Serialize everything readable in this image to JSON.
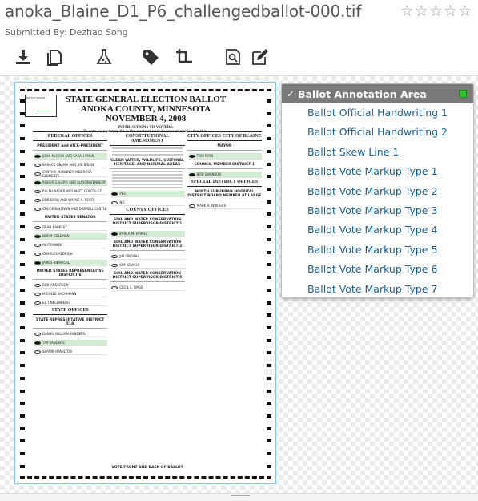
{
  "header": {
    "title": "anoka_Blaine_D1_P6_challengedballot-000.tif",
    "submitted_by": "Submitted By: Dezhao Song",
    "rating_stars": 5,
    "rating_filled": 0,
    "star_glyph": "☆"
  },
  "toolbar": {
    "icons": [
      "download-icon",
      "pages-icon",
      "flask-icon",
      "tag-icon",
      "crop-icon",
      "zoom-icon",
      "edit-icon"
    ]
  },
  "ballot": {
    "stamp_text": "BALLOT BOARD",
    "heading_1": "STATE GENERAL ELECTION BALLOT",
    "heading_2": "ANOKA COUNTY, MINNESOTA",
    "heading_3": "NOVEMBER 4, 2008",
    "instructions_title": "INSTRUCTIONS TO VOTERS:",
    "instructions_text": "To vote, completely fill in the ovals(s) next to your choice(s) like this:",
    "col1_head": "FEDERAL OFFICES",
    "col1_sub1": "PRESIDENT and VICE-PRESIDENT",
    "col1_cands": [
      "JOHN McCAIN AND SARAH PALIN",
      "BARACK OBAMA AND JOE BIDEN",
      "CYNTHIA McKINNEY AND ROSA CLEMENTE",
      "ROGER CALERO AND ALYSON KENNEDY",
      "RALPH NADER AND MATT GONZALEZ",
      "BOB BARR AND WAYNE A. ROOT",
      "CHUCK BALDWIN AND DARRELL CASTLE"
    ],
    "col1_sub2": "UNITED STATES SENATOR",
    "col1_cands2": [
      "DEAN BARKLEY",
      "NORM COLEMAN",
      "AL FRANKEN",
      "CHARLES ALDRICH",
      "JAMES NIEMACKL"
    ],
    "col1_sub3": "UNITED STATES REPRESENTATIVE DISTRICT 6",
    "col1_cands3": [
      "BOB ANDERSON",
      "MICHELE BACHMANN",
      "EL TINKLENBERG"
    ],
    "col1_head2": "STATE OFFICES",
    "col1_sub4": "STATE REPRESENTATIVE DISTRICT 51A",
    "col1_cands4": [
      "DANIEL WILLIAM SANDERS",
      "TIM SANDERS",
      "SHAWN HAMILTON"
    ],
    "col2_head": "CONSTITUTIONAL AMENDMENT",
    "col2_sub1": "CLEAN WATER, WILDLIFE, CULTURAL HERITAGE, AND NATURAL AREAS",
    "col2_yes": "YES",
    "col2_no": "NO",
    "col2_head2": "COUNTY OFFICES",
    "col2_sub2": "SOIL AND WATER CONSERVATION DISTRICT SUPERVISOR DISTRICT 1",
    "col2_cands2": [
      "KARLA M. HOMEC"
    ],
    "col2_sub3": "SOIL AND WATER CONSERVATION DISTRICT SUPERVISOR DISTRICT 2",
    "col2_cands3": [
      "JIM LINDAHL",
      "KIM KOVICH"
    ],
    "col2_sub4": "SOIL AND WATER CONSERVATION DISTRICT SUPERVISOR DISTRICT 5",
    "col2_cands4": [
      "CECIL L. WASS"
    ],
    "col3_head": "CITY OFFICES CITY OF BLAINE",
    "col3_sub1": "MAYOR",
    "col3_cands1": [
      "TOM RYAN"
    ],
    "col3_sub2": "COUNCIL MEMBER DISTRICT 1",
    "col3_cands2": [
      "BOB SWANSON"
    ],
    "col3_head2": "SPECIAL DISTRICT OFFICES",
    "col3_sub3": "NORTH SUBURBAN HOSPITAL DISTRICT BOARD MEMBER AT LARGE",
    "col3_cands3": [
      "MARK A. WINTERS"
    ],
    "footer": "VOTE FRONT AND BACK OF BALLOT"
  },
  "annotations": {
    "header_label": "Ballot Annotation Area",
    "accent_color": "#2ec02e",
    "items": [
      "Ballot Official Handwriting 1",
      "Ballot Official Handwriting 2",
      "Ballot Skew Line 1",
      "Ballot Vote Markup Type 1",
      "Ballot Vote Markup Type 2",
      "Ballot Vote Markup Type 3",
      "Ballot Vote Markup Type 4",
      "Ballot Vote Markup Type 5",
      "Ballot Vote Markup Type 6",
      "Ballot Vote Markup Type 7"
    ]
  }
}
